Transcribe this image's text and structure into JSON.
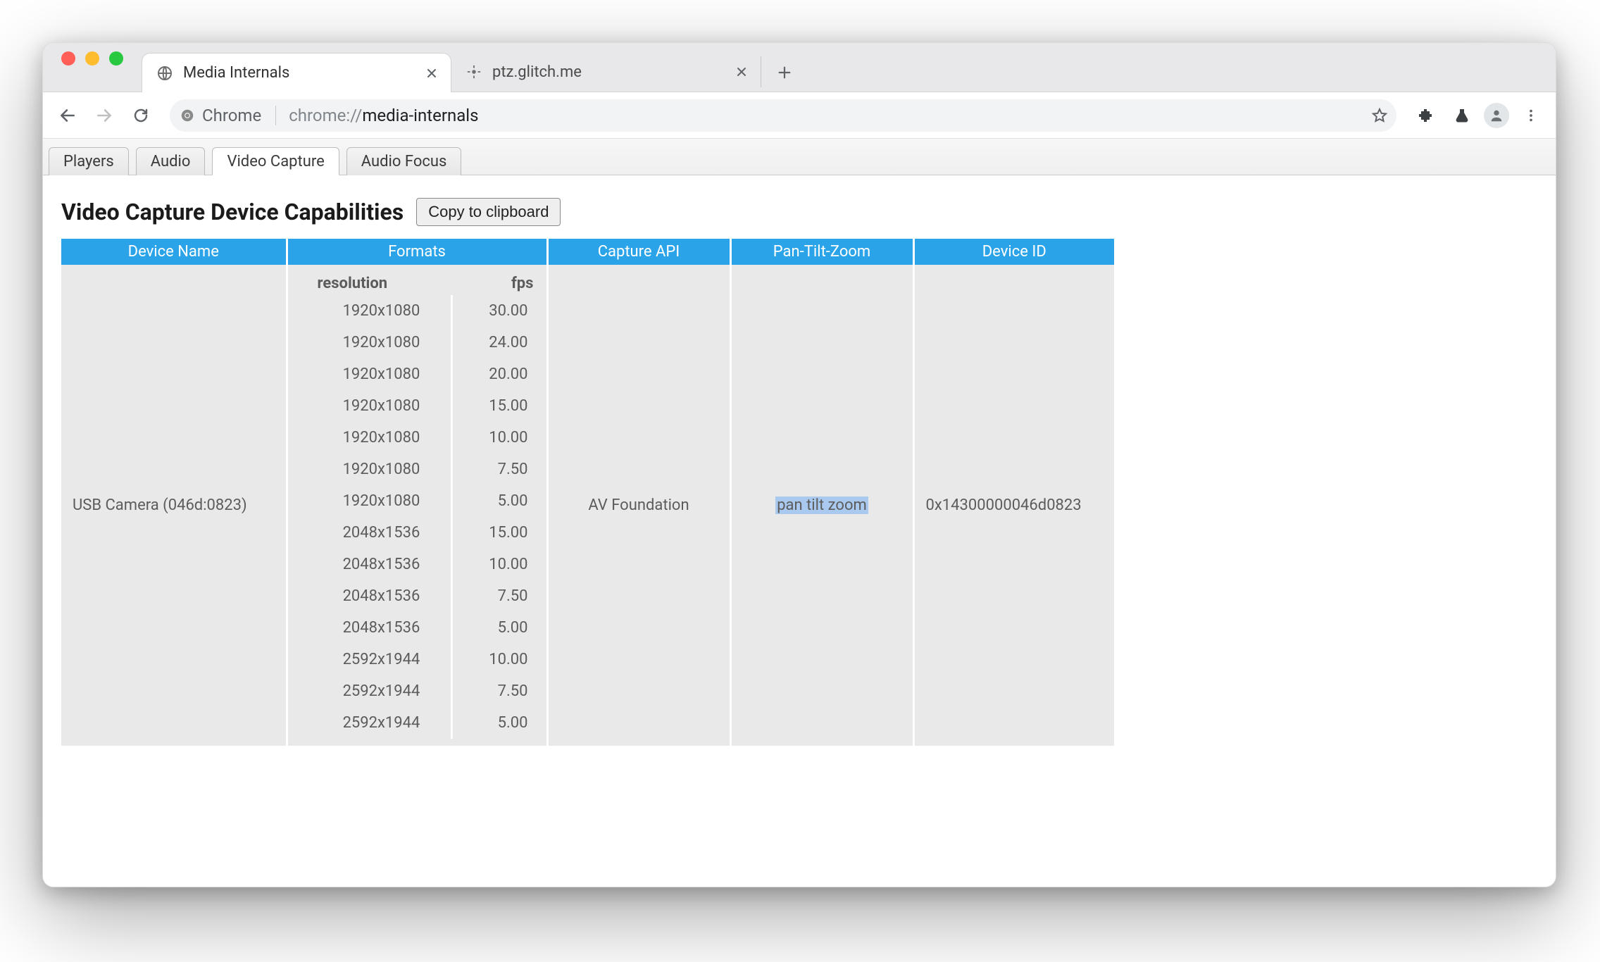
{
  "browser": {
    "tabs": [
      {
        "title": "Media Internals",
        "active": true,
        "icon": "globe-icon"
      },
      {
        "title": "ptz.glitch.me",
        "active": false,
        "icon": "crosshair-icon"
      }
    ],
    "omnibox": {
      "chip_label": "Chrome",
      "url_prefix": "chrome://",
      "url_path": "media-internals"
    }
  },
  "page": {
    "tabs": [
      "Players",
      "Audio",
      "Video Capture",
      "Audio Focus"
    ],
    "active_tab_index": 2,
    "heading": "Video Capture Device Capabilities",
    "copy_button": "Copy to clipboard",
    "table": {
      "columns": [
        "Device Name",
        "Formats",
        "Capture API",
        "Pan-Tilt-Zoom",
        "Device ID"
      ],
      "format_columns": [
        "resolution",
        "fps"
      ],
      "rows": [
        {
          "device_name": "USB Camera (046d:0823)",
          "capture_api": "AV Foundation",
          "ptz": "pan tilt zoom",
          "device_id": "0x14300000046d0823",
          "formats": [
            {
              "resolution": "1920x1080",
              "fps": "30.00"
            },
            {
              "resolution": "1920x1080",
              "fps": "24.00"
            },
            {
              "resolution": "1920x1080",
              "fps": "20.00"
            },
            {
              "resolution": "1920x1080",
              "fps": "15.00"
            },
            {
              "resolution": "1920x1080",
              "fps": "10.00"
            },
            {
              "resolution": "1920x1080",
              "fps": "7.50"
            },
            {
              "resolution": "1920x1080",
              "fps": "5.00"
            },
            {
              "resolution": "2048x1536",
              "fps": "15.00"
            },
            {
              "resolution": "2048x1536",
              "fps": "10.00"
            },
            {
              "resolution": "2048x1536",
              "fps": "7.50"
            },
            {
              "resolution": "2048x1536",
              "fps": "5.00"
            },
            {
              "resolution": "2592x1944",
              "fps": "10.00"
            },
            {
              "resolution": "2592x1944",
              "fps": "7.50"
            },
            {
              "resolution": "2592x1944",
              "fps": "5.00"
            }
          ]
        }
      ]
    }
  }
}
